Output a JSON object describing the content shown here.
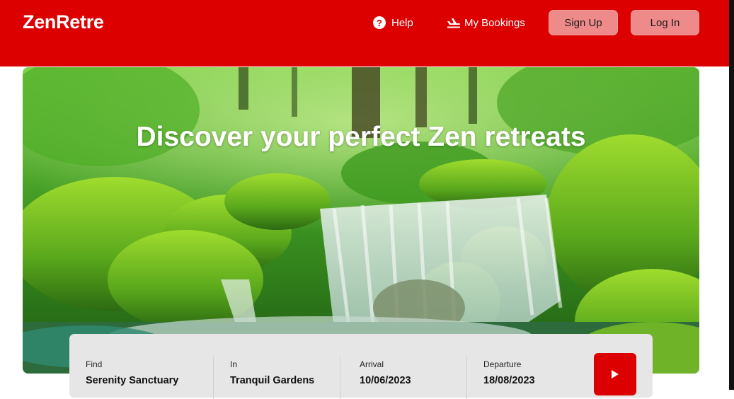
{
  "header": {
    "logo": "ZenRetre",
    "nav": {
      "help_label": "Help",
      "help_icon": "question-circle-icon",
      "bookings_label": "My Bookings",
      "bookings_icon": "plane-landing-icon"
    },
    "signup_label": "Sign Up",
    "login_label": "Log In"
  },
  "hero": {
    "title": "Discover your perfect Zen retreats",
    "image": "forest-waterfall-mossy-rocks"
  },
  "search": {
    "find": {
      "label": "Find",
      "value": "Serenity Sanctuary"
    },
    "in": {
      "label": "In",
      "value": "Tranquil Gardens"
    },
    "arrival": {
      "label": "Arrival",
      "value": "10/06/2023"
    },
    "departure": {
      "label": "Departure",
      "value": "18/08/2023"
    },
    "submit_icon": "play-arrow-icon"
  },
  "colors": {
    "brand": "#dc0000",
    "button": "#ee8a8a",
    "panel": "#e6e6e6"
  }
}
